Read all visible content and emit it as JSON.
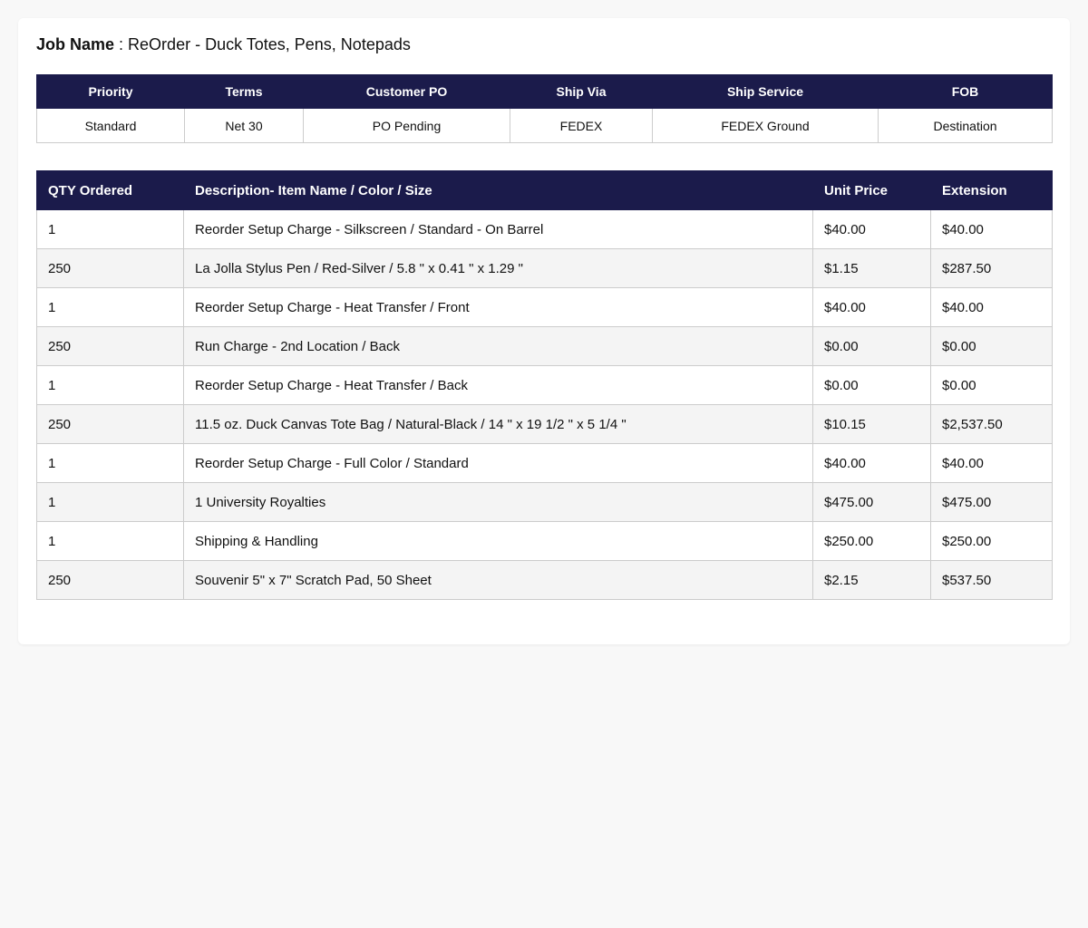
{
  "job": {
    "label": "Job Name",
    "separator": " : ",
    "value": "ReOrder - Duck Totes, Pens, Notepads"
  },
  "meta": {
    "headers": [
      "Priority",
      "Terms",
      "Customer PO",
      "Ship Via",
      "Ship Service",
      "FOB"
    ],
    "values": [
      "Standard",
      "Net 30",
      "PO Pending",
      "FEDEX",
      "FEDEX Ground",
      "Destination"
    ]
  },
  "items": {
    "headers": [
      "QTY Ordered",
      "Description- Item Name / Color / Size",
      "Unit Price",
      "Extension"
    ],
    "rows": [
      [
        "1",
        "Reorder Setup Charge - Silkscreen / Standard - On Barrel",
        "$40.00",
        "$40.00"
      ],
      [
        "250",
        "La Jolla Stylus Pen / Red-Silver / 5.8 \" x 0.41 \" x 1.29 \"",
        "$1.15",
        "$287.50"
      ],
      [
        "1",
        "Reorder Setup Charge - Heat Transfer / Front",
        "$40.00",
        "$40.00"
      ],
      [
        "250",
        "Run Charge - 2nd Location / Back",
        "$0.00",
        "$0.00"
      ],
      [
        "1",
        "Reorder Setup Charge - Heat Transfer / Back",
        "$0.00",
        "$0.00"
      ],
      [
        "250",
        "11.5 oz. Duck Canvas Tote Bag / Natural-Black / 14 \" x 19 1/2 \" x 5 1/4 \"",
        "$10.15",
        "$2,537.50"
      ],
      [
        "1",
        "Reorder Setup Charge - Full Color / Standard",
        "$40.00",
        "$40.00"
      ],
      [
        "1",
        "1 University Royalties",
        "$475.00",
        "$475.00"
      ],
      [
        "1",
        "Shipping & Handling",
        "$250.00",
        "$250.00"
      ],
      [
        "250",
        "Souvenir 5\" x 7\" Scratch Pad, 50 Sheet",
        "$2.15",
        "$537.50"
      ]
    ]
  },
  "colors": {
    "header_bg": "#1b1b4b",
    "header_text": "#ffffff",
    "row_alt_bg": "#f4f4f4",
    "border": "#cccccc"
  }
}
